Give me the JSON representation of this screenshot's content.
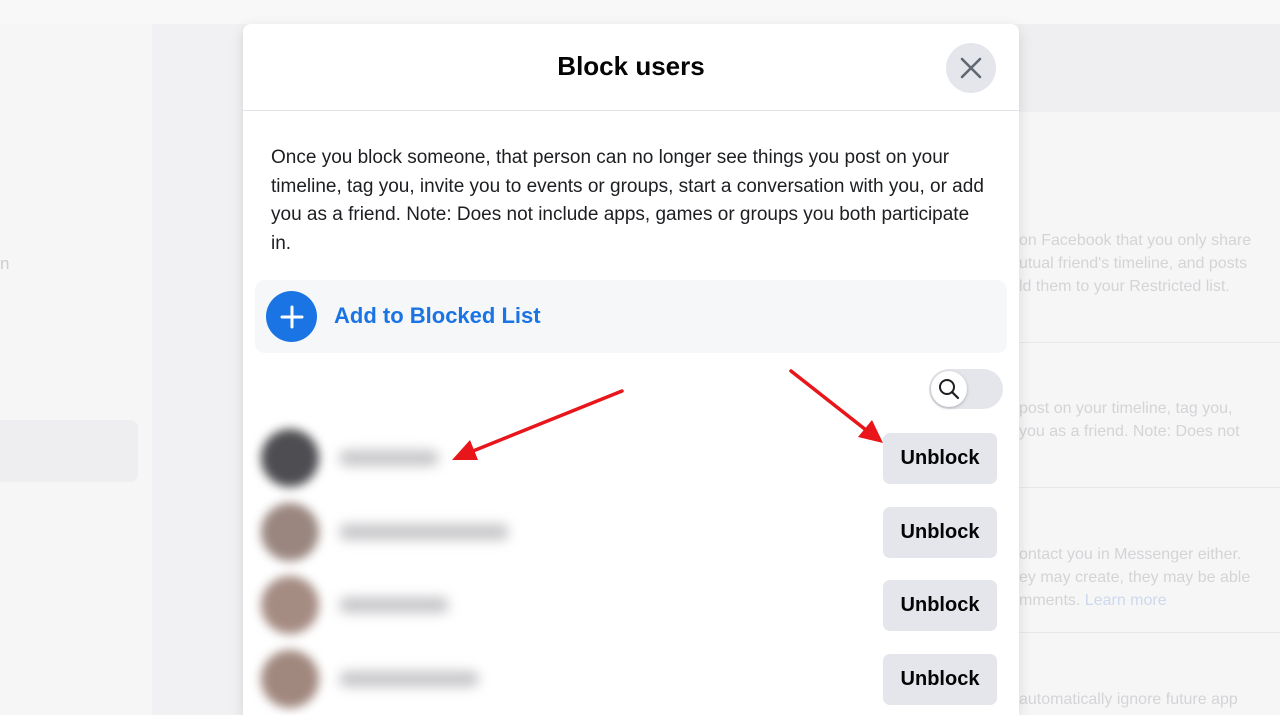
{
  "background": {
    "left_fragment": "n",
    "right_sections": [
      {
        "lines": [
          "on Facebook that you only share",
          "utual friend's timeline, and posts",
          "ld them to your Restricted list."
        ],
        "link": ""
      },
      {
        "lines": [
          "post on your timeline, tag you,",
          "you as a friend. Note: Does not"
        ],
        "link": ""
      },
      {
        "lines": [
          "ontact you in Messenger either.",
          "ey may create, they may be able",
          "mments."
        ],
        "link": "Learn more"
      },
      {
        "lines": [
          "automatically ignore future app"
        ],
        "link": ""
      }
    ]
  },
  "modal": {
    "title": "Block users",
    "close_icon": "close-icon",
    "description": "Once you block someone, that person can no longer see things you post on your timeline, tag you, invite you to events or groups, start a conversation with you, or add you as a friend. Note: Does not include apps, games or groups you both participate in.",
    "add_button": {
      "label": "Add to Blocked List",
      "icon": "plus-icon"
    },
    "search_toggle": {
      "icon": "search-icon"
    },
    "blocked_users": [
      {
        "avatar_color": "#4e4e52",
        "unblock_label": "Unblock"
      },
      {
        "avatar_color": "#9a867f",
        "unblock_label": "Unblock"
      },
      {
        "avatar_color": "#a58c83",
        "unblock_label": "Unblock"
      },
      {
        "avatar_color": "#a1887e",
        "unblock_label": "Unblock"
      }
    ]
  },
  "colors": {
    "accent": "#1b74e4",
    "button_bg": "#e4e6eb",
    "annotation_arrow": "#e8161b"
  }
}
